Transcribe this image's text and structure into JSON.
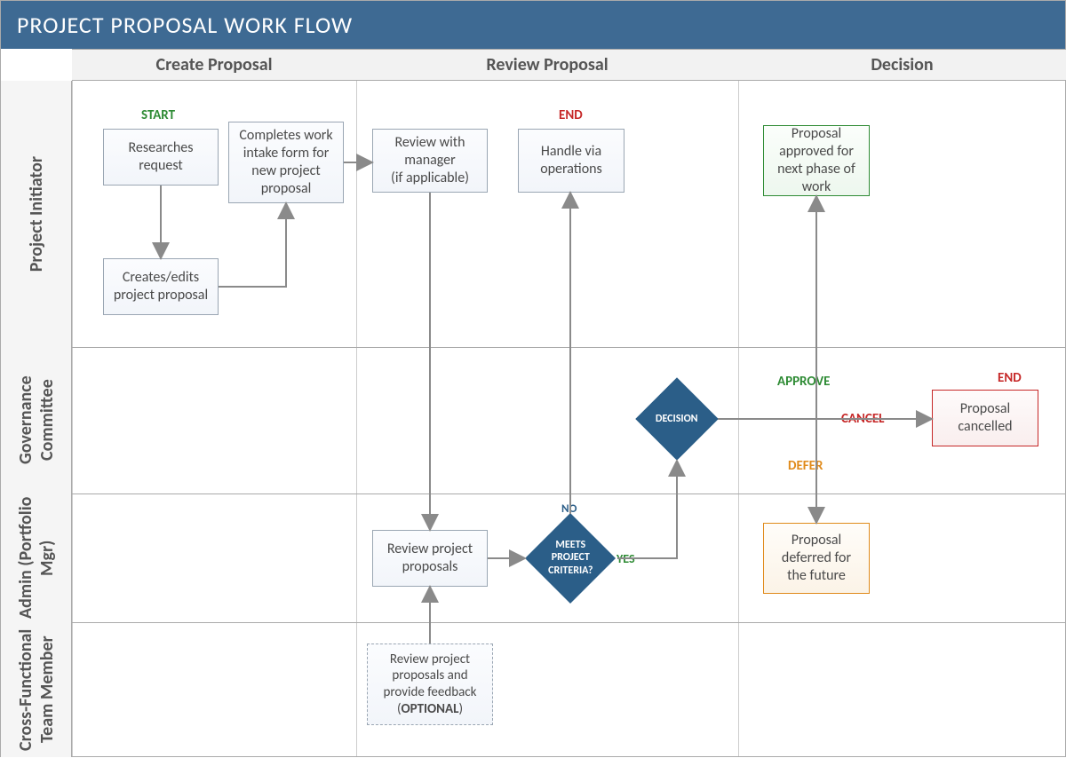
{
  "title": "PROJECT PROPOSAL WORK FLOW",
  "columns": {
    "create": "Create Proposal",
    "review": "Review Proposal",
    "decision": "Decision"
  },
  "lanes": {
    "initiator": "Project Initiator",
    "governance": "Governance Committee",
    "admin": "Admin (Portfolio Mgr)",
    "cross": "Cross-Functional Team Member"
  },
  "labels": {
    "start": "START",
    "end": "END",
    "end2": "END",
    "approve": "APPROVE",
    "cancel": "CANCEL",
    "defer": "DEFER",
    "yes": "YES",
    "no": "NO"
  },
  "nodes": {
    "research": "Researches request",
    "creates": "Creates/edits project proposal",
    "intake": "Completes work intake form for new project proposal",
    "review_mgr": "Review with manager\n(if applicable)",
    "handle_ops": "Handle via operations",
    "decision": "DECISION",
    "approved": "Proposal approved for next phase of work",
    "review_proj": "Review project proposals",
    "criteria": "MEETS PROJECT CRITERIA?",
    "cancelled": "Proposal cancelled",
    "deferred": "Proposal deferred for the future",
    "cross_review": "Review project proposals and provide feedback (OPTIONAL)"
  }
}
